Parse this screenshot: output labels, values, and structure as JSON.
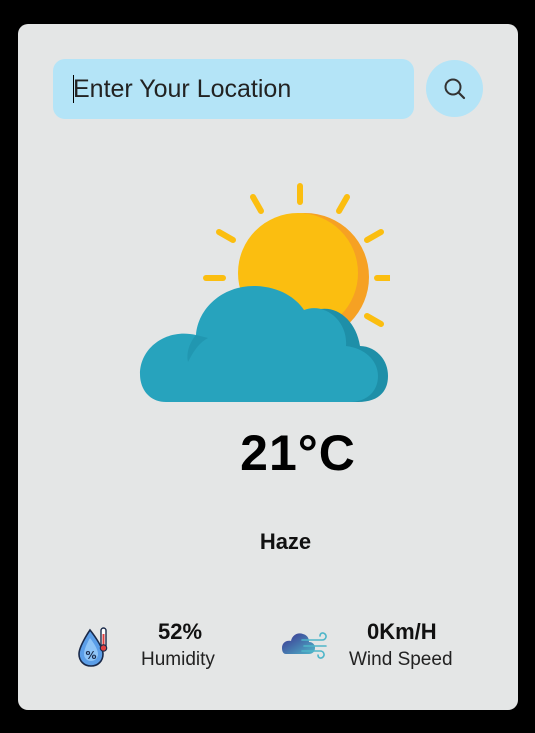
{
  "search": {
    "placeholder": "Enter Your Location",
    "button_icon": "search-icon"
  },
  "weather": {
    "icon": "sun-behind-cloud-icon",
    "temperature": "21°C",
    "description": "Haze"
  },
  "stats": {
    "humidity": {
      "value": "52%",
      "label": "Humidity",
      "icon": "humidity-icon"
    },
    "wind": {
      "value": "0Km/H",
      "label": "Wind Speed",
      "icon": "wind-icon"
    }
  },
  "colors": {
    "background": "#000000",
    "card": "#e4e6e6",
    "accent": "#b4e4f7",
    "sun": "#fbbe10",
    "cloud": "#27a3bd"
  }
}
